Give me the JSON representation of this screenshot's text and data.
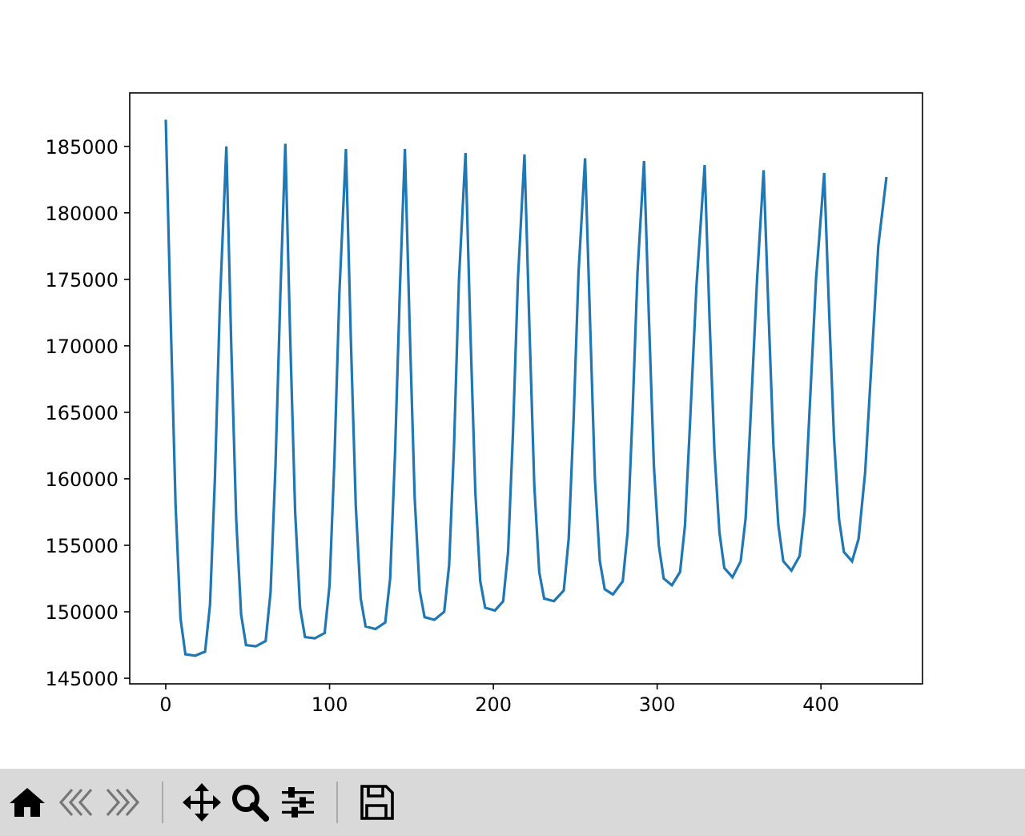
{
  "figure": {
    "chart_data": {
      "type": "line",
      "xlim": [
        -22,
        462
      ],
      "ylim": [
        144580,
        189020
      ],
      "xticks": [
        0,
        100,
        200,
        300,
        400
      ],
      "yticks": [
        145000,
        150000,
        155000,
        160000,
        165000,
        170000,
        175000,
        180000,
        185000
      ],
      "x": [
        0,
        3,
        6,
        9,
        12,
        18,
        24,
        27,
        30,
        33,
        37,
        40,
        43,
        46,
        49,
        55,
        61,
        64,
        67,
        70,
        73,
        76,
        79,
        82,
        85,
        91,
        97,
        100,
        103,
        106,
        110,
        113,
        116,
        119,
        122,
        128,
        134,
        137,
        140,
        143,
        146,
        149,
        152,
        155,
        158,
        164,
        170,
        173,
        176,
        179,
        183,
        186,
        189,
        192,
        195,
        201,
        206,
        209,
        212,
        215,
        219,
        222,
        225,
        228,
        231,
        237,
        243,
        246,
        249,
        252,
        256,
        259,
        262,
        265,
        268,
        273,
        279,
        282,
        285,
        288,
        292,
        295,
        298,
        301,
        304,
        309,
        314,
        317,
        320,
        324,
        329,
        332,
        335,
        338,
        341,
        346,
        351,
        354,
        357,
        361,
        365,
        368,
        371,
        374,
        377,
        382,
        387,
        390,
        393,
        397,
        402,
        405,
        408,
        411,
        414,
        419,
        423,
        427,
        431,
        435,
        440
      ],
      "series": [
        {
          "color": "#1f77b4",
          "values": [
            187000,
            172000,
            158000,
            149500,
            146800,
            146700,
            147000,
            150500,
            160000,
            173000,
            185000,
            170000,
            157000,
            149800,
            147500,
            147400,
            147800,
            151500,
            161000,
            174000,
            185200,
            170500,
            157500,
            150300,
            148100,
            148000,
            148400,
            152000,
            161500,
            174000,
            184800,
            170500,
            158000,
            151000,
            148900,
            148700,
            149200,
            152500,
            162000,
            174500,
            184800,
            171000,
            158500,
            151600,
            149600,
            149400,
            150000,
            153500,
            162500,
            175000,
            184500,
            171000,
            159000,
            152300,
            150300,
            150100,
            150800,
            154500,
            163500,
            175000,
            184400,
            171500,
            159500,
            153000,
            151000,
            150800,
            151600,
            155500,
            164500,
            175500,
            184100,
            172000,
            160000,
            153800,
            151700,
            151300,
            152300,
            156000,
            165000,
            175500,
            183900,
            172000,
            161000,
            155000,
            152500,
            152000,
            153000,
            156500,
            164000,
            174500,
            183600,
            172000,
            162000,
            156000,
            153300,
            152600,
            153800,
            157000,
            164500,
            175000,
            183200,
            172500,
            162500,
            156500,
            153800,
            153100,
            154200,
            157500,
            165000,
            175000,
            183000,
            172500,
            163000,
            157000,
            154500,
            153800,
            155500,
            160500,
            169000,
            177500,
            182700
          ]
        }
      ]
    }
  },
  "toolbar": {
    "buttons": [
      {
        "kind": "home",
        "disabled": false
      },
      {
        "kind": "back",
        "disabled": true
      },
      {
        "kind": "forward",
        "disabled": true
      },
      {
        "kind": "separator"
      },
      {
        "kind": "pan",
        "disabled": false
      },
      {
        "kind": "zoom",
        "disabled": false
      },
      {
        "kind": "configure",
        "disabled": false
      },
      {
        "kind": "separator"
      },
      {
        "kind": "save",
        "disabled": false
      }
    ]
  }
}
